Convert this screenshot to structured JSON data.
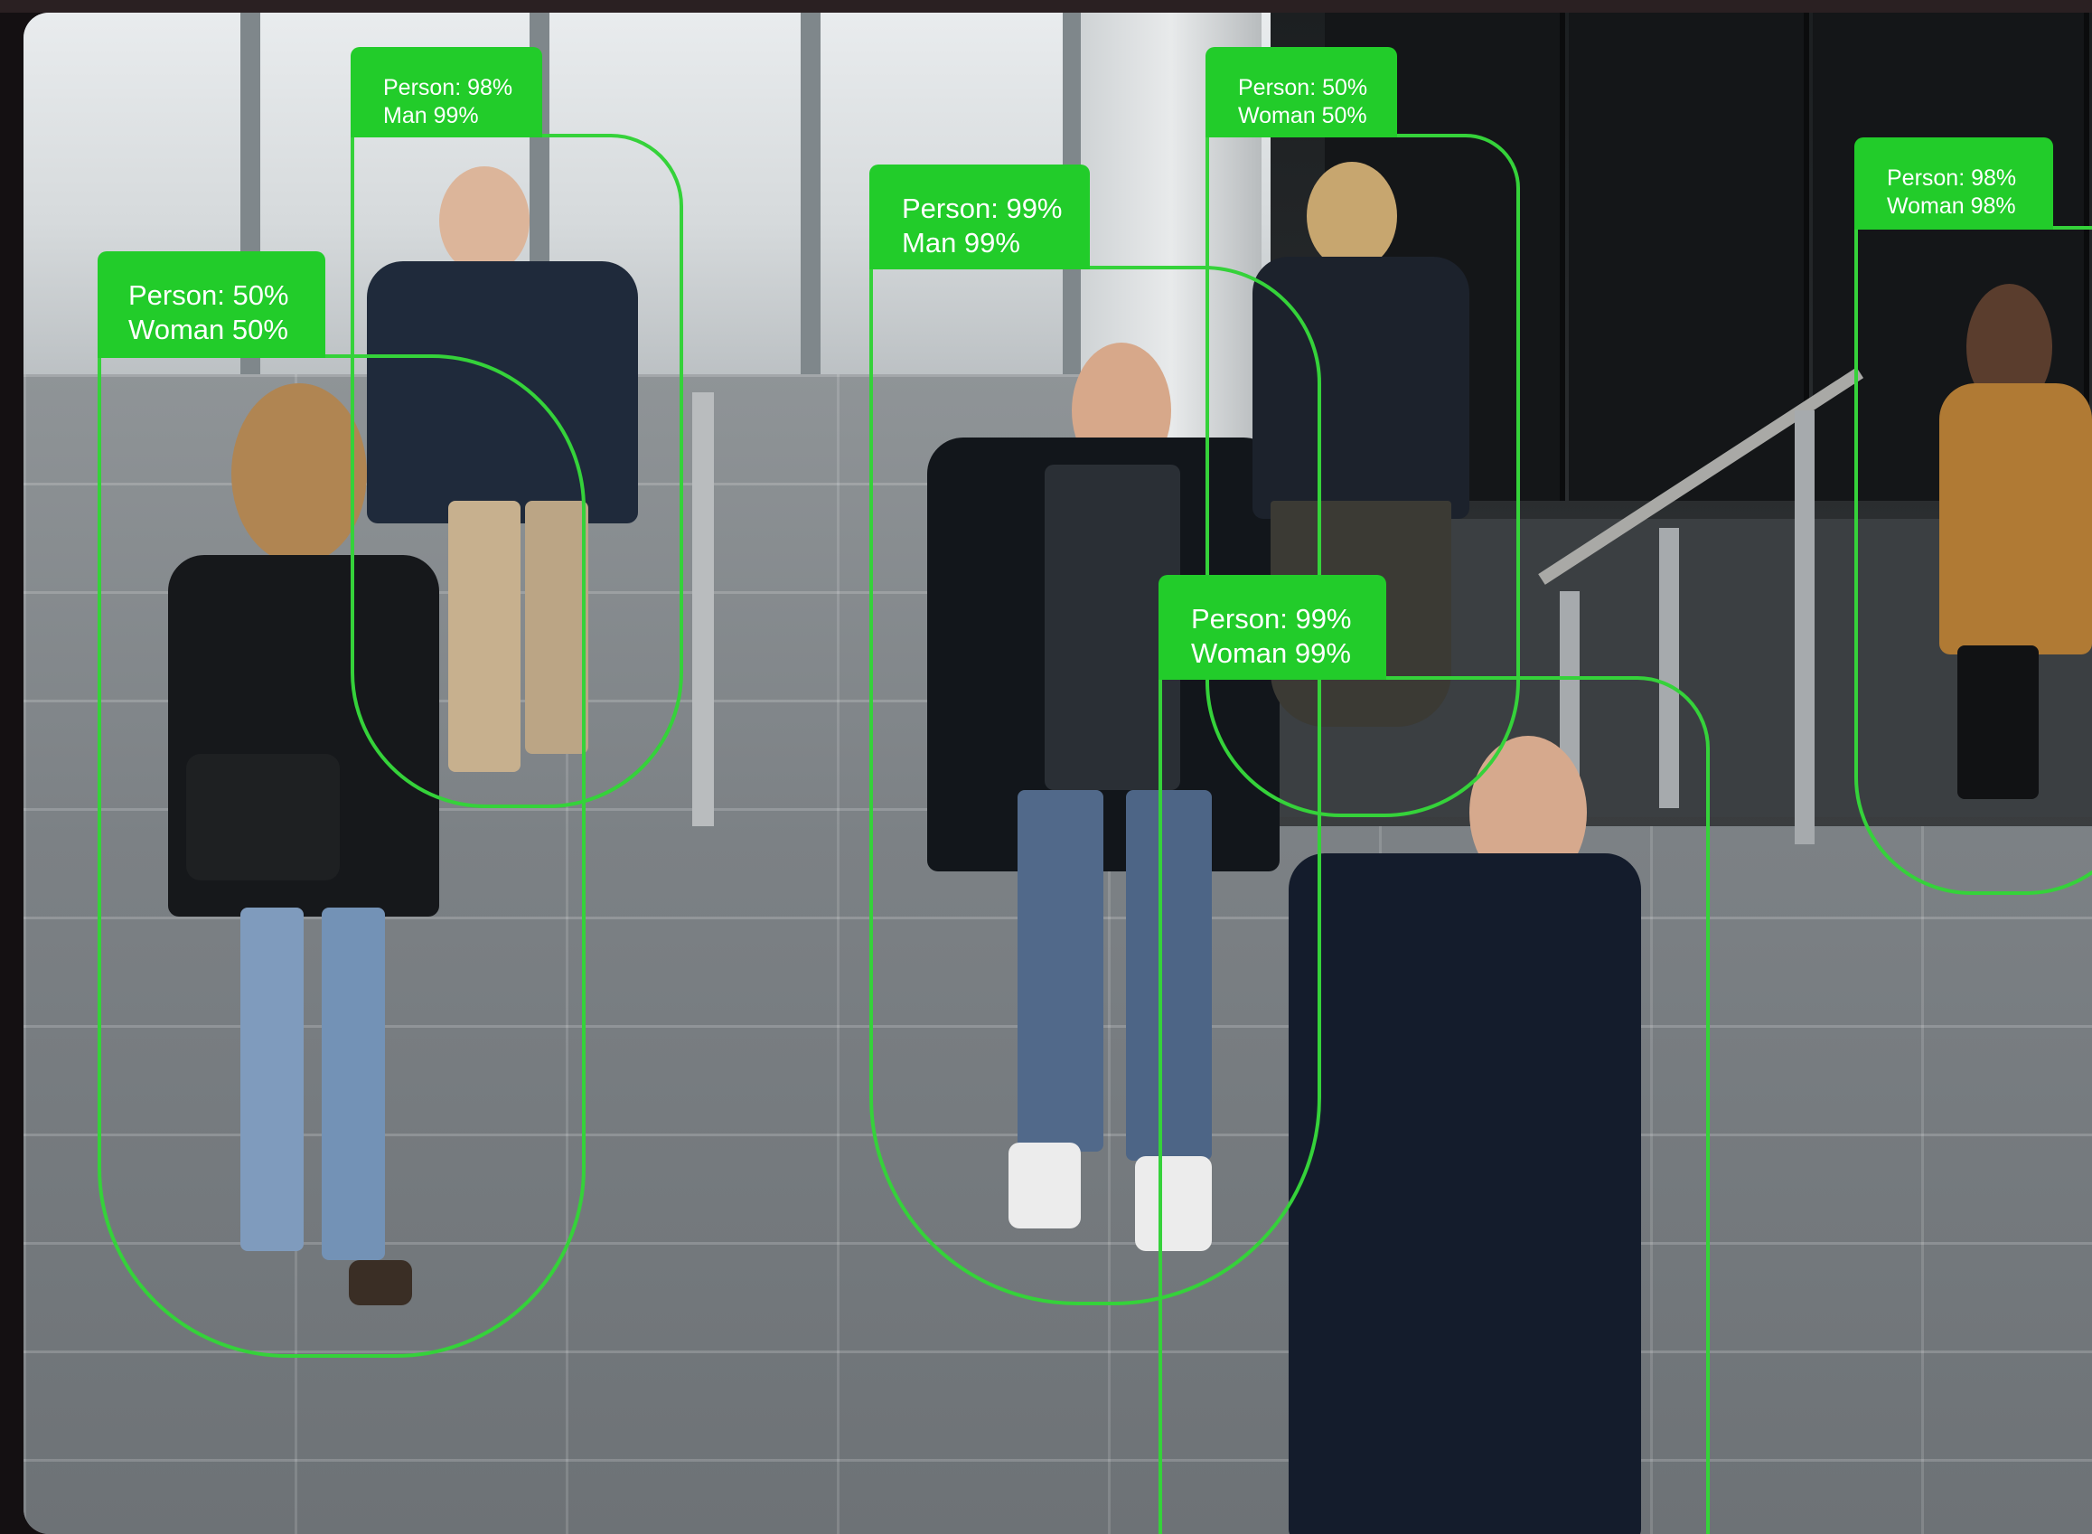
{
  "colors": {
    "detection_box": "#35d23a",
    "detection_label_bg": "#22cc2a",
    "label_text": "#ffffff"
  },
  "detections": [
    {
      "id": "person-a",
      "person": "Person: 50%",
      "gender": "Woman 50%"
    },
    {
      "id": "person-b",
      "person": "Person: 98%",
      "gender": "Man 99%"
    },
    {
      "id": "person-c",
      "person": "Person: 99%",
      "gender": "Man 99%"
    },
    {
      "id": "person-d",
      "person": "Person: 50%",
      "gender": "Woman 50%"
    },
    {
      "id": "person-e",
      "person": "Person: 99%",
      "gender": "Woman 99%"
    },
    {
      "id": "person-f",
      "person": "Person: 98%",
      "gender": "Woman 98%"
    }
  ]
}
